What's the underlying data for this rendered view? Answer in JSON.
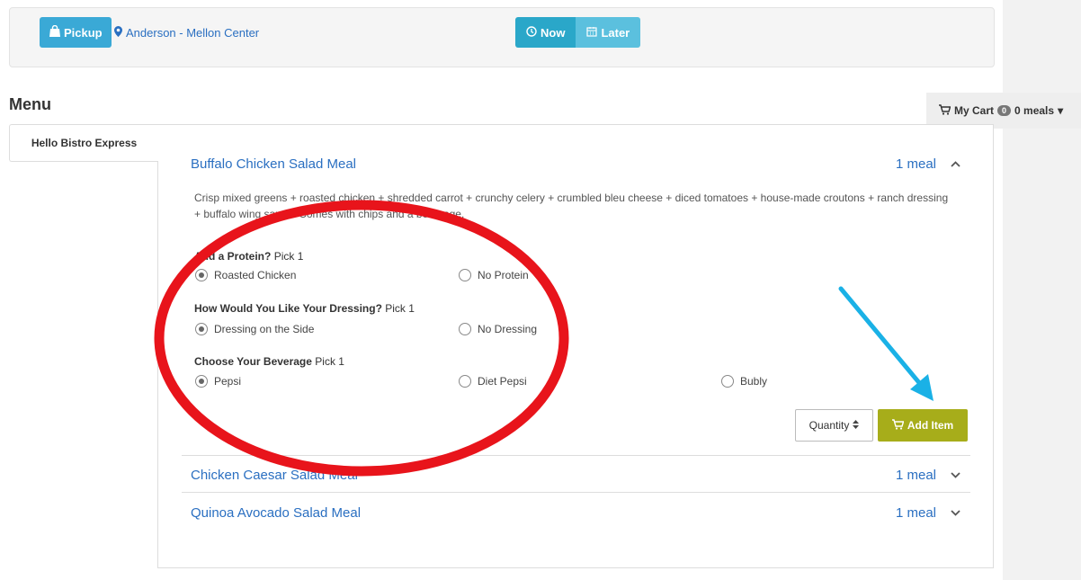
{
  "header": {
    "pickup_label": "Pickup",
    "location_label": "Anderson - Mellon Center",
    "now_label": "Now",
    "later_label": "Later"
  },
  "menu": {
    "heading": "Menu",
    "tabs": [
      {
        "label": "Hello Bistro Express"
      }
    ]
  },
  "cart": {
    "label": "My Cart",
    "count": "0",
    "meals": "0 meals",
    "caret": "▾"
  },
  "items": [
    {
      "title": "Buffalo Chicken Salad Meal",
      "quantity_text": "1 meal",
      "expanded": true,
      "description": "Crisp mixed greens + roasted chicken + shredded carrot + crunchy celery + crumbled bleu cheese + diced tomatoes + house-made croutons + ranch dressing + buffalo wing sauce. Comes with chips and a beverage.",
      "option_groups": [
        {
          "title": "Add a Protein?",
          "hint": "Pick 1",
          "options": [
            "Roasted Chicken",
            "No Protein"
          ],
          "selected": 0
        },
        {
          "title": "How Would You Like Your Dressing?",
          "hint": "Pick 1",
          "options": [
            "Dressing on the Side",
            "No Dressing"
          ],
          "selected": 0
        },
        {
          "title": "Choose Your Beverage",
          "hint": "Pick 1",
          "options": [
            "Pepsi",
            "Diet Pepsi",
            "Bubly"
          ],
          "selected": 0
        }
      ],
      "quantity_label": "Quantity",
      "add_label": "Add Item"
    },
    {
      "title": "Chicken Caesar Salad Meal",
      "quantity_text": "1 meal",
      "expanded": false
    },
    {
      "title": "Quinoa Avocado Salad Meal",
      "quantity_text": "1 meal",
      "expanded": false
    }
  ],
  "icons": {
    "pickup": "shopping-bag-icon",
    "location": "map-marker-icon",
    "now": "clock-icon",
    "later": "calendar-icon",
    "cart": "shopping-cart-icon",
    "expanded": "chevron-up-icon",
    "collapsed": "chevron-down-icon",
    "sort": "sort-icon"
  },
  "colors": {
    "primary_blue": "#3aa9d6",
    "now_button": "#2aa7c9",
    "later_button": "#5bc0de",
    "link_blue": "#2a6fc1",
    "add_button": "#a7ad1a",
    "annotation_ellipse": "#e8141b",
    "annotation_arrow": "#1ab1e6"
  }
}
